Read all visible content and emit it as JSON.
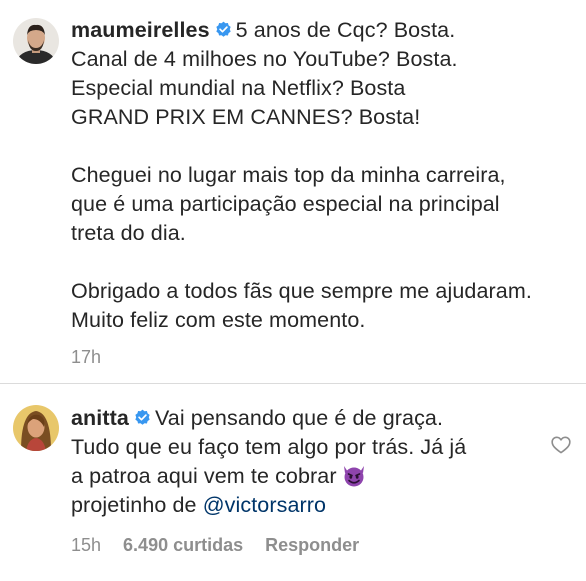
{
  "comments": [
    {
      "username": "maumeirelles",
      "lines": [
        "5 anos de Cqc? Bosta.",
        "Canal de 4 milhoes no YouTube? Bosta.",
        "Especial mundial na Netflix? Bosta",
        "GRAND PRIX EM CANNES? Bosta!",
        "",
        "Cheguei no lugar mais top da minha carreira,",
        "que é uma participação especial na principal",
        "treta do dia.",
        "",
        "Obrigado a todos fãs que sempre me ajudaram.",
        "Muito feliz com este momento."
      ],
      "time": "17h",
      "verified_icon": "verified-badge-icon"
    },
    {
      "username": "anitta",
      "lines": [
        "Vai pensando que é de graça.",
        "Tudo que eu faço tem algo por trás. Já já",
        "a patroa aqui vem te cobrar",
        "projetinho de"
      ],
      "mention": "@victorsarro",
      "emoji": "smiling-devil-emoji",
      "time": "15h",
      "likes": "6.490 curtidas",
      "reply": "Responder",
      "like_icon": "heart-outline-icon"
    }
  ],
  "colors": {
    "text": "#262626",
    "meta": "#8e8e8e",
    "verified": "#3897f0",
    "mention": "#003569",
    "divider": "#dbdbdb"
  }
}
